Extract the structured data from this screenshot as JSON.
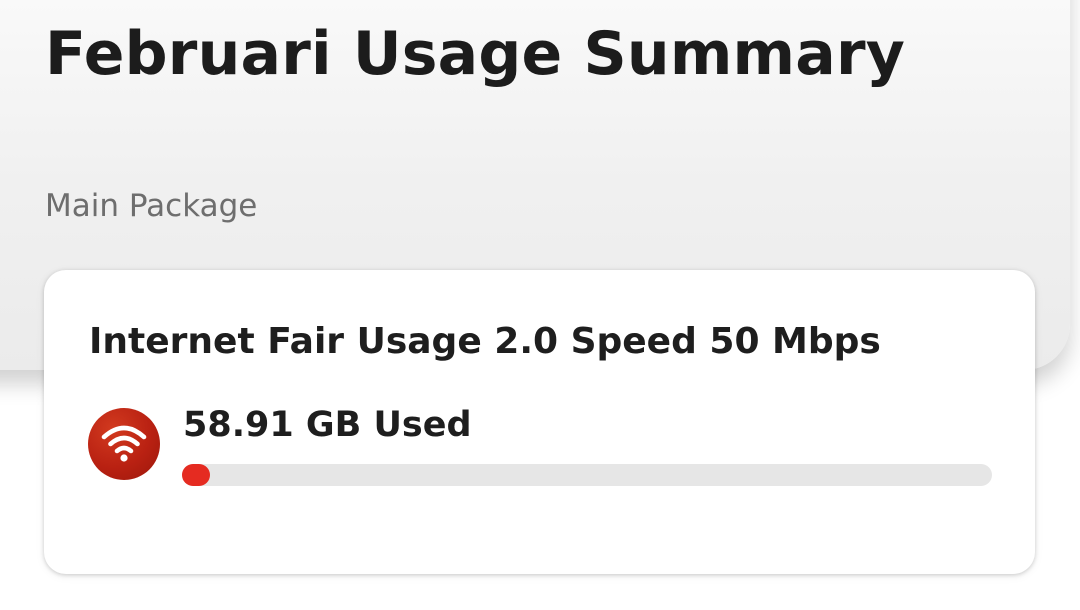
{
  "header": {
    "title": "Februari Usage Summary",
    "section_label": "Main Package"
  },
  "package": {
    "name": "Internet Fair Usage 2.0 Speed 50 Mbps",
    "usage_text": "58.91 GB Used",
    "icon": "wifi-icon",
    "usage_fraction": 0.0
  },
  "colors": {
    "accent": "#e52b21",
    "icon_background": "#b92112",
    "track": "#e6e6e6",
    "header_background": "#efefef"
  }
}
